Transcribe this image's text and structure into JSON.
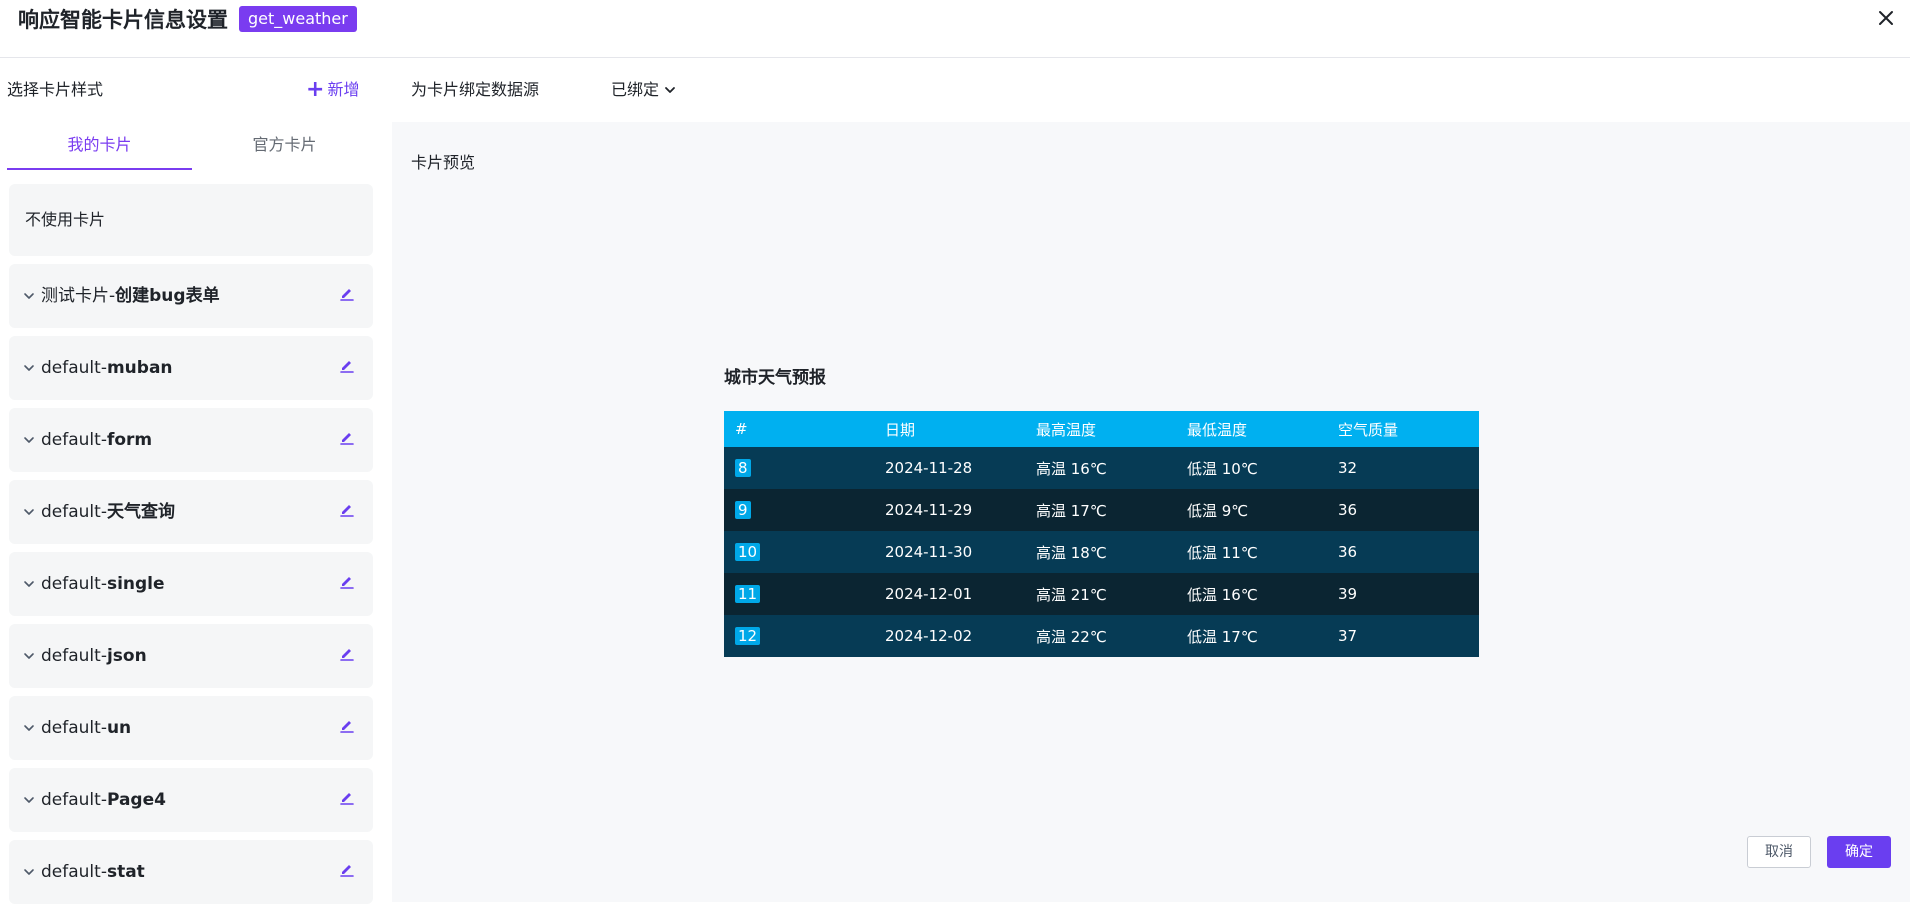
{
  "header": {
    "title": "响应智能卡片信息设置",
    "tag": "get_weather"
  },
  "left": {
    "label": "选择卡片样式",
    "add_label": "新增",
    "tabs": [
      "我的卡片",
      "官方卡片"
    ],
    "no_card": "不使用卡片",
    "cards": [
      {
        "prefix": "测试卡片-",
        "bold": "创建bug表单"
      },
      {
        "prefix": "default-",
        "bold": "muban"
      },
      {
        "prefix": "default-",
        "bold": "form"
      },
      {
        "prefix": "default-",
        "bold": "天气查询"
      },
      {
        "prefix": "default-",
        "bold": "single"
      },
      {
        "prefix": "default-",
        "bold": "json"
      },
      {
        "prefix": "default-",
        "bold": "un"
      },
      {
        "prefix": "default-",
        "bold": "Page4"
      },
      {
        "prefix": "default-",
        "bold": "stat"
      }
    ]
  },
  "bind": {
    "label": "为卡片绑定数据源",
    "status": "已绑定"
  },
  "preview": {
    "label": "卡片预览",
    "weather_title": "城市天气预报",
    "columns": [
      "#",
      "日期",
      "最高温度",
      "最低温度",
      "空气质量"
    ],
    "rows": [
      [
        "8",
        "2024-11-28",
        "高温 16℃",
        "低温 10℃",
        "32"
      ],
      [
        "9",
        "2024-11-29",
        "高温 17℃",
        "低温 9℃",
        "36"
      ],
      [
        "10",
        "2024-11-30",
        "高温 18℃",
        "低温 11℃",
        "36"
      ],
      [
        "11",
        "2024-12-01",
        "高温 21℃",
        "低温 16℃",
        "39"
      ],
      [
        "12",
        "2024-12-02",
        "高温 22℃",
        "低温 17℃",
        "37"
      ]
    ]
  },
  "footer": {
    "cancel": "取消",
    "ok": "确定"
  },
  "colors": {
    "accent": "#7a3cf0",
    "table_header": "#00b0f0",
    "row_odd": "#063b55",
    "row_even": "#0b2532"
  }
}
